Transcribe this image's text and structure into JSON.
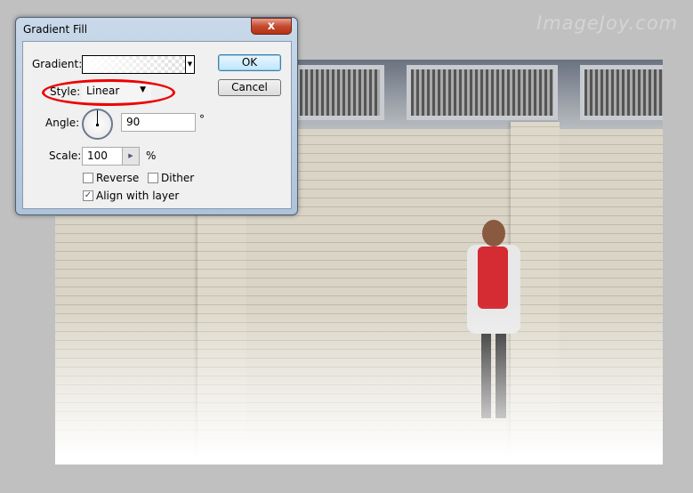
{
  "watermark": "ImageJoy.com",
  "dialog": {
    "title": "Gradient Fill",
    "close_label": "x",
    "gradient_label": "Gradient:",
    "style_label": "Style:",
    "style_value": "Linear",
    "angle_label": "Angle:",
    "angle_value": "90",
    "angle_unit": "°",
    "scale_label": "Scale:",
    "scale_value": "100",
    "scale_unit": "%",
    "reverse_label": "Reverse",
    "reverse_checked": false,
    "dither_label": "Dither",
    "dither_checked": false,
    "align_label": "Align with layer",
    "align_checked": true,
    "ok_label": "OK",
    "cancel_label": "Cancel",
    "highlight_color": "#e00000"
  }
}
